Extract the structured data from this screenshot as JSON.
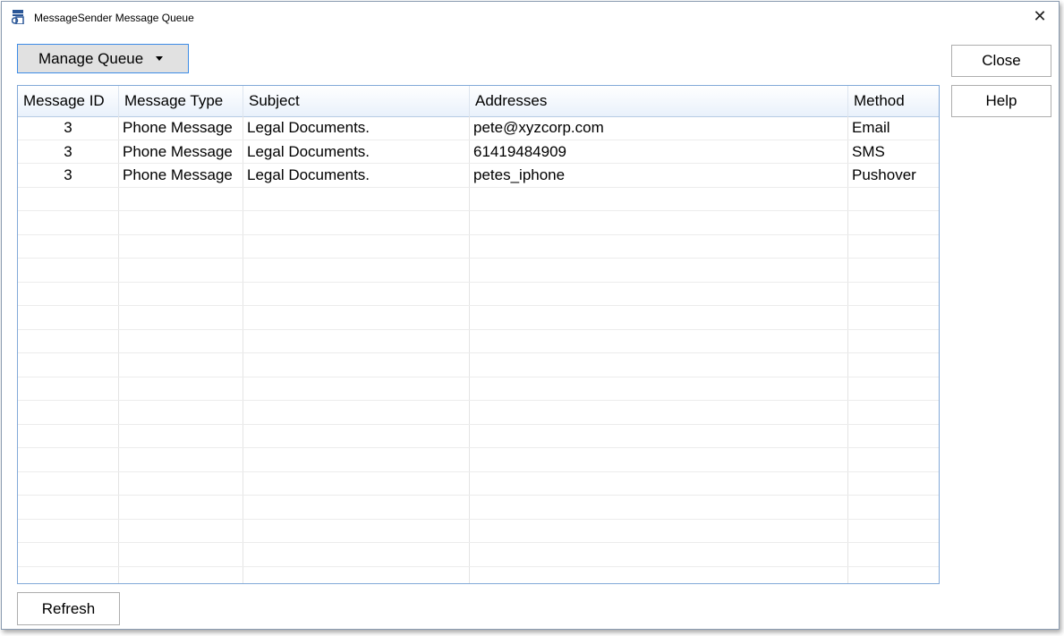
{
  "window": {
    "title": "MessageSender Message Queue"
  },
  "toolbar": {
    "manage_queue_label": "Manage Queue",
    "close_label": "Close",
    "help_label": "Help",
    "refresh_label": "Refresh"
  },
  "table": {
    "columns": [
      "Message ID",
      "Message Type",
      "Subject",
      "Addresses",
      "Method"
    ],
    "rows": [
      {
        "id": "3",
        "type": "Phone Message",
        "subject": "Legal Documents.",
        "address": "pete@xyzcorp.com",
        "method": "Email"
      },
      {
        "id": "3",
        "type": "Phone Message",
        "subject": "Legal Documents.",
        "address": "61419484909",
        "method": "SMS"
      },
      {
        "id": "3",
        "type": "Phone Message",
        "subject": "Legal Documents.",
        "address": "petes_iphone",
        "method": "Pushover"
      }
    ]
  },
  "icons": {
    "app": "app-icon",
    "close": "close-icon",
    "dropdown": "caret-down-icon"
  },
  "colors": {
    "focus_border": "#3c8be6",
    "grid_border": "#82a9d8",
    "header_gradient_bottom": "#e9f1fb"
  }
}
